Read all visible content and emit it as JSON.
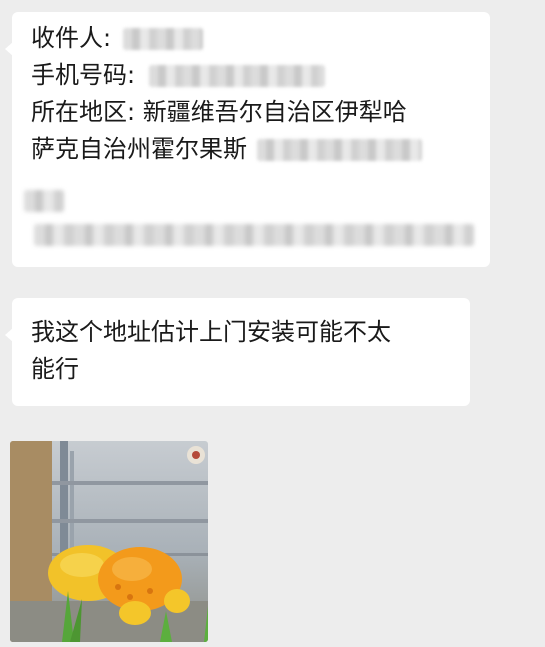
{
  "messages": [
    {
      "id": "address",
      "lines": [
        {
          "label": "收件人:",
          "value": "",
          "redacted": true
        },
        {
          "label": "手机号码:",
          "value": "",
          "redacted": true
        },
        {
          "label": "所在地区:",
          "value": "新疆维吾尔自治区伊犁哈"
        },
        {
          "label": "萨克自治州霍尔果斯",
          "value": "",
          "redacted": true
        }
      ],
      "redacted_tail": true
    },
    {
      "id": "message",
      "lines": [
        "我这个地址估计上门安装可能不太",
        "能行"
      ]
    },
    {
      "id": "image",
      "type": "sticker-image",
      "icon": "cartoon-character-image"
    }
  ],
  "colors": {
    "background": "#ededed",
    "bubble": "#ffffff",
    "text": "#1a1a1a"
  }
}
